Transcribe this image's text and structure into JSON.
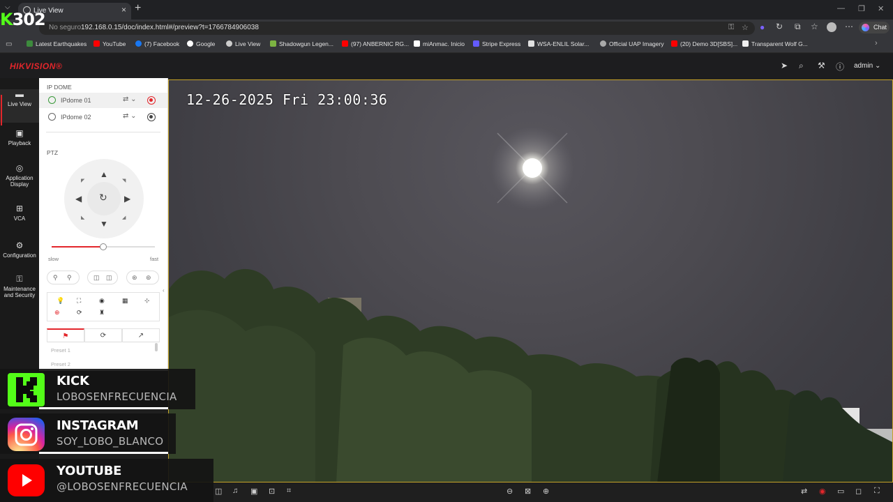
{
  "browser": {
    "tab_title": "Live View",
    "address_security": "No seguro",
    "url": "192.168.0.15/doc/index.html#/preview?t=1766784906038",
    "chat_label": "Chat",
    "bookmarks": [
      {
        "label": "Latest Earthquakes",
        "color": "#3d8b3d"
      },
      {
        "label": "YouTube",
        "color": "#ff0000"
      },
      {
        "label": "(7) Facebook",
        "color": "#1877f2"
      },
      {
        "label": "Google",
        "color": "#ffffff"
      },
      {
        "label": "Live View",
        "color": "#cccccc"
      },
      {
        "label": "Shadowgun Legen...",
        "color": "#7cb342"
      },
      {
        "label": "(97) ANBERNIC RG...",
        "color": "#ff0000"
      },
      {
        "label": "miAnmac. Inicio",
        "color": "#ffffff"
      },
      {
        "label": "Stripe Express",
        "color": "#635bff"
      },
      {
        "label": "WSA-ENLIL Solar...",
        "color": "#e0e0e0"
      },
      {
        "label": "Official UAP Imagery",
        "color": "#aaaaaa"
      },
      {
        "label": "(20) Demo 3D[SBS]...",
        "color": "#ff0000"
      },
      {
        "label": "Transparent Wolf G...",
        "color": "#f0f0f0"
      }
    ]
  },
  "app": {
    "logo": "HIKVISION®",
    "user": "admin",
    "accent": "#e3262b"
  },
  "nav": [
    {
      "label": "Live View",
      "icon": "monitor-icon"
    },
    {
      "label": "Playback",
      "icon": "playback-icon"
    },
    {
      "label": "Application Display",
      "icon": "application-icon"
    },
    {
      "label": "VCA",
      "icon": "vca-icon"
    },
    {
      "label": "Configuration",
      "icon": "gear-icon"
    },
    {
      "label": "Maintenance and Security",
      "icon": "maintenance-icon"
    }
  ],
  "panel": {
    "group": "IP DOME",
    "cameras": [
      {
        "name": "IPdome 01",
        "recording": true
      },
      {
        "name": "IPdome 02",
        "recording": false
      }
    ],
    "ptz_label": "PTZ",
    "speed_slow": "slow",
    "speed_fast": "fast",
    "speed_value": 0.5,
    "presets": [
      "Preset 1",
      "Preset 2"
    ]
  },
  "video": {
    "osd": "12-26-2025 Fri 23:00:36"
  },
  "overlay": {
    "channel_tag_k": "K",
    "channel_tag_num": "302",
    "socials": [
      {
        "name": "KICK",
        "handle": "LOBOSENFRECUENCIA"
      },
      {
        "name": "INSTAGRAM",
        "handle": "SOY_LOBO_BLANCO"
      },
      {
        "name": "YOUTUBE",
        "handle": "@LOBOSENFRECUENCIA"
      }
    ]
  }
}
